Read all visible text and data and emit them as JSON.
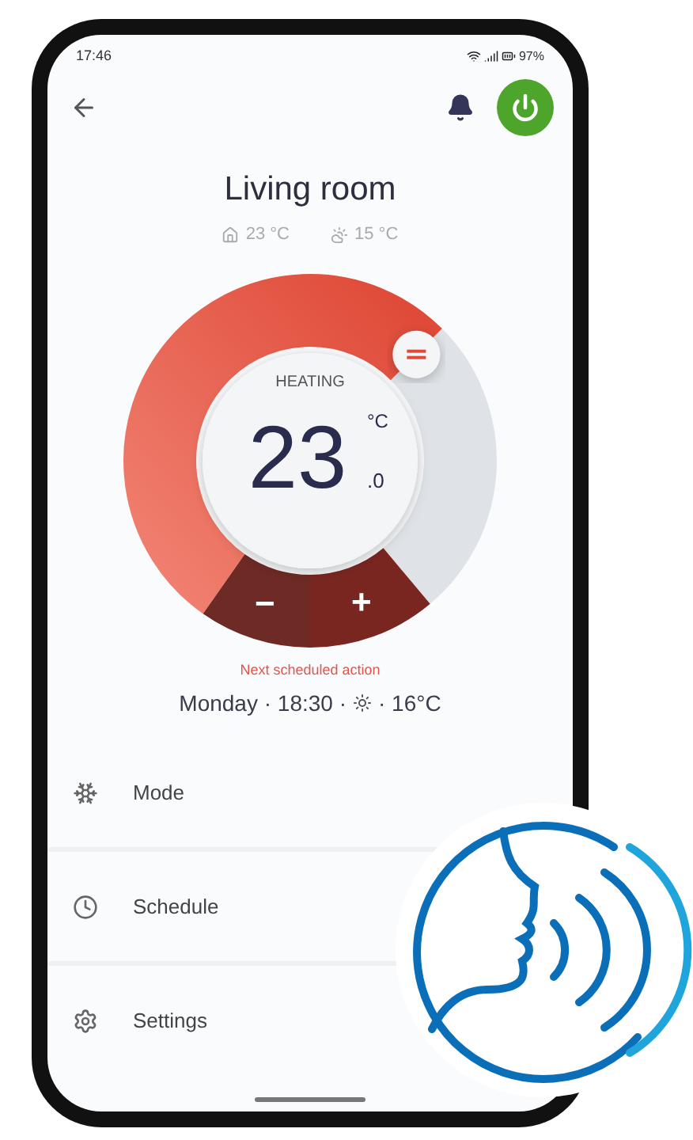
{
  "status_bar": {
    "time": "17:46",
    "battery": "97%"
  },
  "header": {
    "power_on": true
  },
  "room": {
    "name": "Living room",
    "indoor": "23 °C",
    "outdoor": "15 °C"
  },
  "thermostat": {
    "mode_label": "HEATING",
    "temperature": "23",
    "unit": "°C",
    "decimal": ".0",
    "buttons": [
      "−",
      "+"
    ]
  },
  "next_action": {
    "label": "Next scheduled action",
    "before": "Monday · 18:30 ·",
    "after": "· 16°C"
  },
  "menu": [
    {
      "kind": "mode",
      "label": "Mode"
    },
    {
      "kind": "schedule",
      "label": "Schedule"
    },
    {
      "kind": "settings",
      "label": "Settings"
    }
  ]
}
